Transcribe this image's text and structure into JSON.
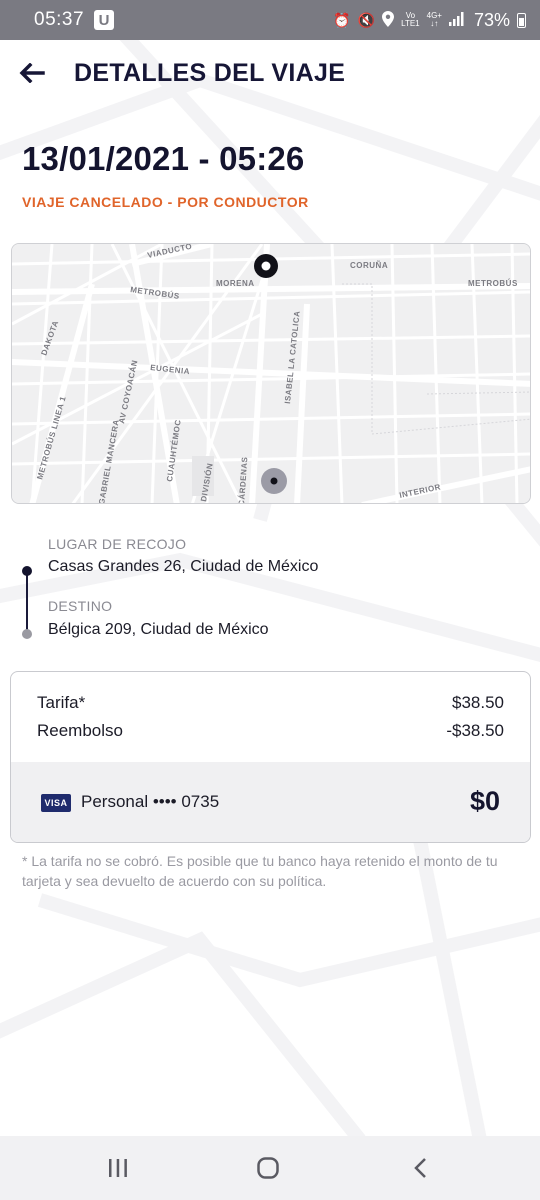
{
  "status_bar": {
    "time": "05:37",
    "app_badge": "U",
    "network_top": "Vo",
    "network_bottom": "LTE1",
    "data_top": "4G+",
    "data_bottom": "↓↑",
    "battery": "73%"
  },
  "header": {
    "title": "DETALLES DEL VIAJE"
  },
  "trip": {
    "datetime": "13/01/2021 - 05:26",
    "status": "VIAJE CANCELADO - POR CONDUCTOR"
  },
  "map": {
    "labels": {
      "viaducto": "VIADUCTO",
      "morena": "MORENA",
      "coruna": "CORUÑA",
      "metrobus_right": "METROBÚS",
      "metrobus_left": "METROBÚS",
      "dakota": "DAKOTA",
      "eugenia": "EUGENIA",
      "isabel": "ISABEL LA CATOLICA",
      "av_coyoacan": "AV COYOACÁN",
      "linea1": "METROBÚS LINEA 1",
      "cuauhtemoc": "CUAUHTÉMOC",
      "gabriel": "GABRIEL MANCERA",
      "division": "DIVISIÓN",
      "cardenas": "CÁRDENAS",
      "interior": "INTERIOR"
    }
  },
  "route": {
    "pickup_label": "LUGAR DE RECOJO",
    "pickup_address": "Casas Grandes 26, Ciudad de México",
    "destination_label": "DESTINO",
    "destination_address": "Bélgica 209, Ciudad de México"
  },
  "fare": {
    "rows": [
      {
        "label": "Tarifa*",
        "amount": "$38.50"
      },
      {
        "label": "Reembolso",
        "amount": "-$38.50"
      }
    ],
    "card_brand": "VISA",
    "payment_label": "Personal •••• 0735",
    "total": "$0"
  },
  "note": "*  La tarifa no se cobró. Es posible que tu banco haya retenido el monto de tu tarjeta y sea devuelto de acuerdo con su política.",
  "colors": {
    "accent": "#e0642a",
    "primary": "#14142e",
    "card_brand": "#1f2b6d"
  },
  "navigation": {
    "recents_icon": "recents-icon",
    "home_icon": "home-icon",
    "back_icon": "back-icon"
  }
}
